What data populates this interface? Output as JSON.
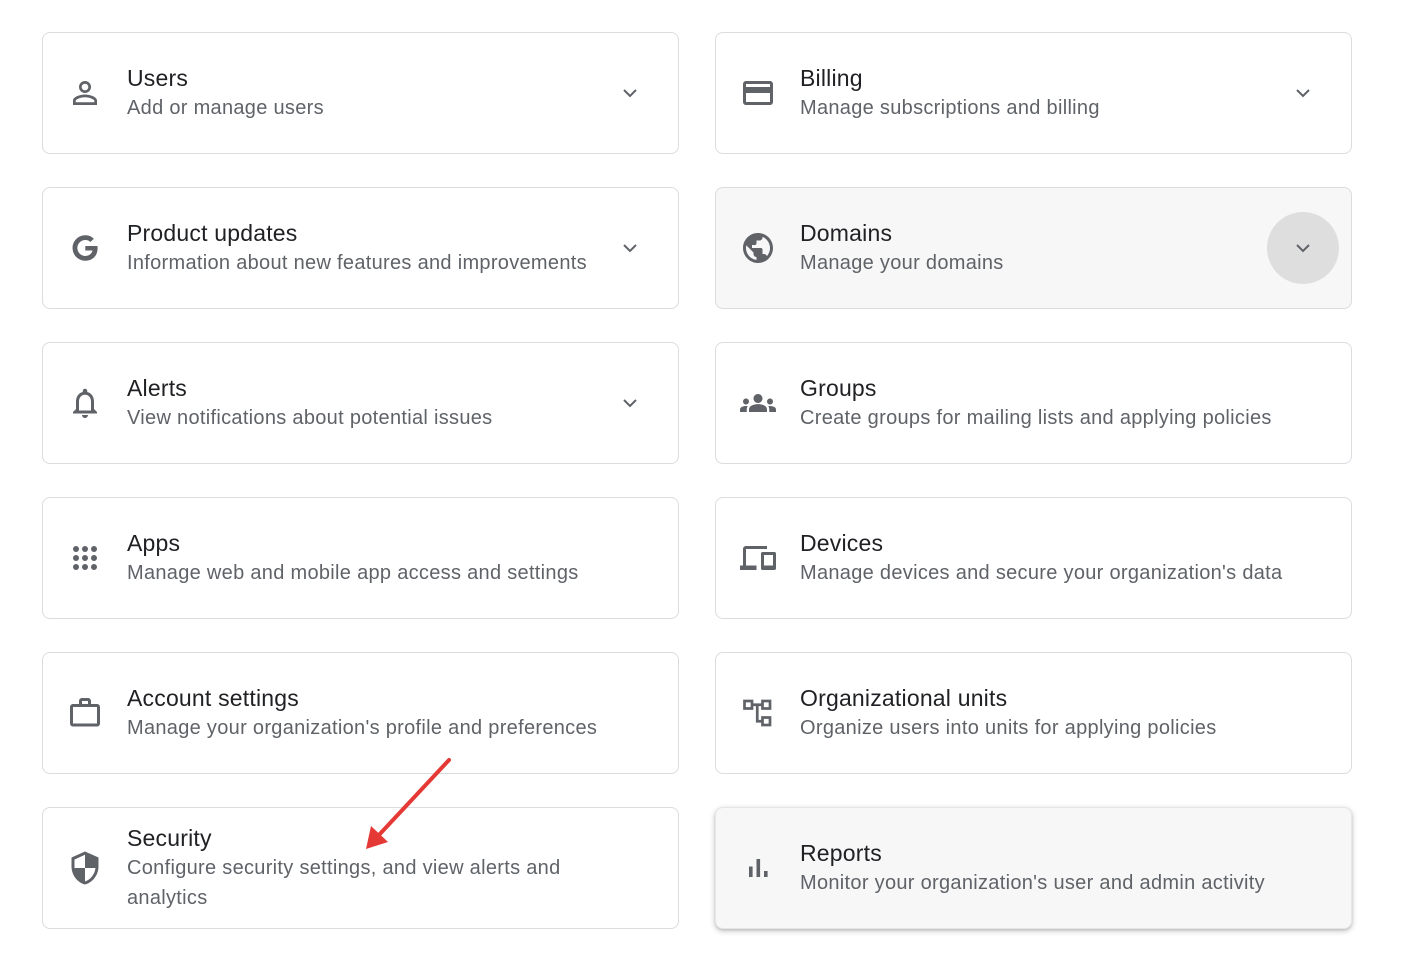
{
  "cards": [
    {
      "title": "Users",
      "description": "Add or manage users",
      "icon": "person-icon"
    },
    {
      "title": "Billing",
      "description": "Manage subscriptions and billing",
      "icon": "credit-card-icon"
    },
    {
      "title": "Product updates",
      "description": "Information about new features and improvements",
      "icon": "google-g-icon"
    },
    {
      "title": "Domains",
      "description": "Manage your domains",
      "icon": "globe-icon"
    },
    {
      "title": "Alerts",
      "description": "View notifications about potential issues",
      "icon": "bell-icon"
    },
    {
      "title": "Groups",
      "description": "Create groups for mailing lists and applying policies",
      "icon": "groups-icon"
    },
    {
      "title": "Apps",
      "description": "Manage web and mobile app access and settings",
      "icon": "apps-grid-icon"
    },
    {
      "title": "Devices",
      "description": "Manage devices and secure your organization's data",
      "icon": "devices-icon"
    },
    {
      "title": "Account settings",
      "description": "Manage your organization's profile and preferences",
      "icon": "briefcase-icon"
    },
    {
      "title": "Organizational units",
      "description": "Organize users into units for applying policies",
      "icon": "org-units-icon"
    },
    {
      "title": "Security",
      "description": "Configure security settings, and view alerts and analytics",
      "icon": "shield-icon"
    },
    {
      "title": "Reports",
      "description": "Monitor your organization's user and admin activity",
      "icon": "bar-chart-icon"
    }
  ],
  "colors": {
    "title": "#202124",
    "description": "#5f6368",
    "icon": "#5f6368",
    "border": "#dadce0",
    "annotation_arrow": "#e53935"
  }
}
